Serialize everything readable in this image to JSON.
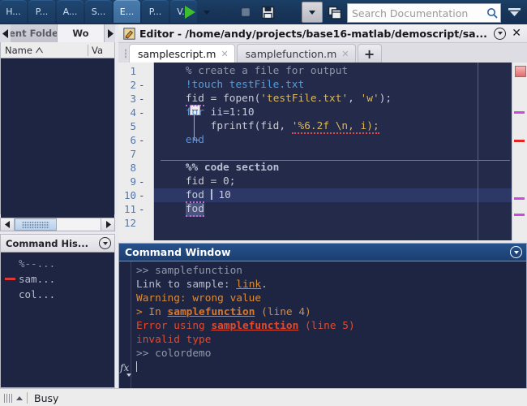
{
  "toolstrip": {
    "tabs": [
      {
        "label": "H...",
        "selected": false
      },
      {
        "label": "P...",
        "selected": false
      },
      {
        "label": "A...",
        "selected": false
      },
      {
        "label": "S...",
        "selected": false
      },
      {
        "label": "E...",
        "selected": true
      },
      {
        "label": "P...",
        "selected": false
      },
      {
        "label": "V...",
        "selected": false
      }
    ],
    "buttons": [
      {
        "name": "run-button",
        "icon": "play-icon"
      },
      {
        "name": "run-dropdown",
        "icon": "chevron-down-icon"
      },
      {
        "name": "run-advance-button",
        "icon": "step-forward-icon"
      },
      {
        "name": "stop-button",
        "icon": "stop-icon"
      },
      {
        "name": "save-button",
        "icon": "floppy-disk-icon"
      },
      {
        "name": "undo-button",
        "icon": "undo-arrow-icon"
      },
      {
        "name": "layout-dropdown-button",
        "icon": "chevron-down-icon"
      },
      {
        "name": "copy-windows-button",
        "icon": "copy-icon"
      }
    ],
    "overflow_label": "»",
    "search": {
      "placeholder": "Search Documentation",
      "value": "",
      "icon": "magnifier-icon"
    },
    "minimize_icon": "chevron-down-icon"
  },
  "left_panel": {
    "tabs": [
      {
        "label": "rent Folder",
        "active": false
      },
      {
        "label": "Wo",
        "active": true
      }
    ],
    "scroll_left_icon": "triangle-left-icon",
    "scroll_right_icon": "triangle-right-icon",
    "workspace": {
      "columns": [
        "Name",
        "Va"
      ],
      "sort_icon": "sort-ascending-icon",
      "rows": []
    },
    "scrollbar": {
      "left_icon": "triangle-left-icon",
      "right_icon": "triangle-right-icon"
    }
  },
  "command_history": {
    "title": "Command His...",
    "collapse_icon": "circle-chevron-down-icon",
    "entries": [
      {
        "text": "%--...",
        "style": "comment",
        "marked": false
      },
      {
        "text": "sam...",
        "style": "normal",
        "marked": true
      },
      {
        "text": "col...",
        "style": "normal",
        "marked": false
      }
    ]
  },
  "editor": {
    "title": "Editor - /home/andy/projects/base16-matlab/demoscript/sa...",
    "doc_icon": "editor-document-icon",
    "collapse_icon": "circle-chevron-down-icon",
    "close_icon": "close-x-icon",
    "tabs": [
      {
        "label": "samplescript.m",
        "active": true,
        "close_icon": "close-x-icon"
      },
      {
        "label": "samplefunction.m",
        "active": false,
        "close_icon": "close-x-icon"
      }
    ],
    "new_tab_label": "+",
    "lines": [
      {
        "num": "1",
        "bp": "",
        "current": false
      },
      {
        "num": "2",
        "bp": "-",
        "current": false
      },
      {
        "num": "3",
        "bp": "-",
        "current": false
      },
      {
        "num": "4",
        "bp": "-",
        "current": false
      },
      {
        "num": "5",
        "bp": "",
        "current": false
      },
      {
        "num": "6",
        "bp": "-",
        "current": false
      },
      {
        "num": "7",
        "bp": "",
        "current": false
      },
      {
        "num": "8",
        "bp": "",
        "current": false
      },
      {
        "num": "9",
        "bp": "-",
        "current": false
      },
      {
        "num": "10",
        "bp": "-",
        "current": true
      },
      {
        "num": "11",
        "bp": "-",
        "current": false
      },
      {
        "num": "12",
        "bp": "",
        "current": false
      }
    ],
    "code_text": [
      "  % create a file for output",
      "  !touch testFile.txt",
      "  fid = fopen('testFile.txt', 'w');",
      "  for ii=1:10",
      "      fprintf(fid, '%6.2f \\n, i);",
      "  end",
      "",
      "  %% code section",
      "  fid = 0;",
      "  fod  10",
      "  fod",
      ""
    ],
    "markers": [
      {
        "type": "overview-box",
        "color": "#e46a6a"
      },
      {
        "type": "mark",
        "color": "#c94cd8"
      },
      {
        "type": "mark",
        "color": "#e02626"
      },
      {
        "type": "mark",
        "color": "#c94cd8"
      },
      {
        "type": "mark",
        "color": "#c94cd8"
      }
    ]
  },
  "command_window": {
    "title": "Command Window",
    "collapse_icon": "circle-chevron-down-icon",
    "fx_label": "fx",
    "lines": [
      {
        "segments": [
          {
            "t": ">> ",
            "c": "prompt"
          },
          {
            "t": "samplefunction",
            "c": "prompt"
          }
        ]
      },
      {
        "segments": [
          {
            "t": "Link to sample: ",
            "c": "norm"
          },
          {
            "t": "link",
            "c": "link"
          },
          {
            "t": ".",
            "c": "norm"
          }
        ]
      },
      {
        "segments": [
          {
            "t": "Warning: wrong value",
            "c": "warn"
          }
        ]
      },
      {
        "segments": [
          {
            "t": "> In ",
            "c": "warn"
          },
          {
            "t": "samplefunction",
            "c": "warn-b"
          },
          {
            "t": " (line 4)",
            "c": "warn"
          }
        ]
      },
      {
        "segments": [
          {
            "t": "Error using ",
            "c": "err"
          },
          {
            "t": "samplefunction",
            "c": "err-b"
          },
          {
            "t": " (line 5)",
            "c": "err"
          }
        ]
      },
      {
        "segments": [
          {
            "t": "invalid type",
            "c": "err"
          }
        ]
      },
      {
        "segments": [
          {
            "t": ">> colordemo",
            "c": "prompt"
          }
        ]
      }
    ]
  },
  "statusbar": {
    "grip_icon": "resize-grip-icon",
    "up_icon": "triangle-up-icon",
    "status_text": "Busy"
  },
  "colors": {
    "toolstrip_blue": "#18365a",
    "editor_bg": "#242b4a",
    "current_line": "#2e3866",
    "cmd_title_blue": "#26528c",
    "accent_green": "#3cbf2e",
    "error_red": "#e04a2e",
    "warn_orange": "#d98b3a",
    "string_gold": "#d9b760",
    "keyword_blue": "#5b8fd6",
    "comment_gray": "#8d93a8"
  }
}
